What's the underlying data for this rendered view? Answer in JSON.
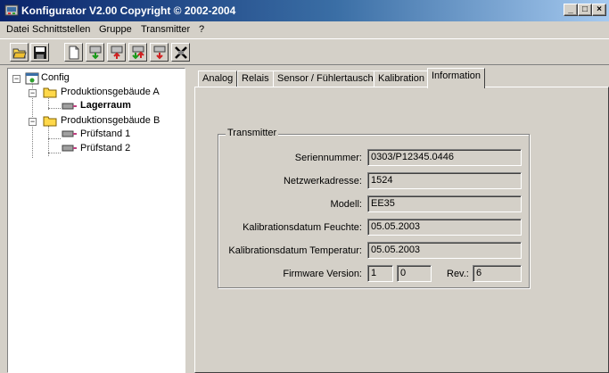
{
  "window": {
    "title": "Konfigurator  V2.00 Copyright © 2002-2004",
    "minimize_glyph": "_",
    "maximize_glyph": "□",
    "close_glyph": "×"
  },
  "menu": [
    "Datei",
    "Schnittstellen",
    "Gruppe",
    "Transmitter",
    "?"
  ],
  "toolbar": {
    "buttons": [
      "open-icon",
      "save-icon",
      "new-icon",
      "download-icon",
      "upload-icon",
      "transfer-icon",
      "transfer-all-icon",
      "disconnect-icon"
    ]
  },
  "tree": {
    "root": "Config",
    "groups": [
      {
        "label": "Produktionsgebäude A",
        "children": [
          "Lagerraum"
        ]
      },
      {
        "label": "Produktionsgebäude B",
        "children": [
          "Prüfstand 1",
          "Prüfstand 2"
        ]
      }
    ],
    "selected": "Lagerraum",
    "expander_open": "−"
  },
  "tabs": [
    "Analog",
    "Relais",
    "Sensor / Fühlertausch",
    "Kalibration",
    "Information"
  ],
  "active_tab": "Information",
  "transmitter": {
    "group_title": "Transmitter",
    "fields": [
      {
        "label": "Seriennummer:",
        "value": "0303/P12345.0446"
      },
      {
        "label": "Netzwerkadresse:",
        "value": "1524"
      },
      {
        "label": "Modell:",
        "value": "EE35"
      },
      {
        "label": "Kalibrationsdatum Feuchte:",
        "value": "05.05.2003"
      },
      {
        "label": "Kalibrationsdatum Temperatur:",
        "value": "05.05.2003"
      }
    ],
    "firmware": {
      "label": "Firmware Version:",
      "major": "1",
      "minor": "0",
      "rev_label": "Rev.:",
      "rev": "6"
    }
  },
  "colors": {
    "titlebar_start": "#0a246a",
    "titlebar_end": "#a6caf0",
    "face": "#d4d0c8",
    "folder": "#ffd84a"
  }
}
